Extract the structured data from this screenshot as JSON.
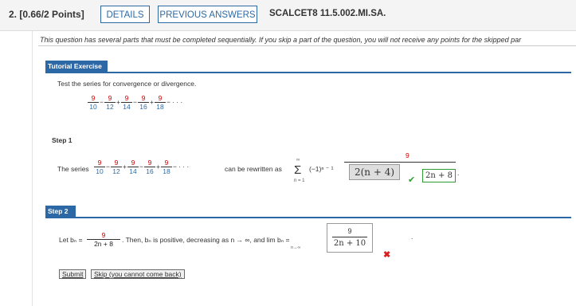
{
  "header": {
    "question_label": "2. [0.66/2 Points]",
    "details_button": "DETAILS",
    "previous_answers_button": "PREVIOUS ANSWERS",
    "problem_code": "SCALCET8 11.5.002.MI.SA."
  },
  "notice": "This question has several parts that must be completed sequentially. If you skip a part of the question, you will not receive any points for the skipped par",
  "tutorial": {
    "tab_label": "Tutorial Exercise",
    "instruction": "Test the series for convergence or divergence.",
    "series_terms": [
      {
        "num": "9",
        "den": "10"
      },
      {
        "num": "9",
        "den": "12"
      },
      {
        "num": "9",
        "den": "14"
      },
      {
        "num": "9",
        "den": "16"
      },
      {
        "num": "9",
        "den": "18"
      }
    ],
    "series_ops": [
      "−",
      "+",
      "−",
      "+",
      "−"
    ],
    "ellipsis": "· · ·"
  },
  "step1": {
    "label": "Step 1",
    "prefix": "The series",
    "rewritten_text": "can be rewritten as",
    "sigma_top": "∞",
    "sigma_bottom": "n = 1",
    "power_term": "(−1)ⁿ ⁻ ¹",
    "fraction_numerator": "9",
    "answer_box": "2(n + 4)",
    "correct_answer": "2n + 8",
    "trailing": "."
  },
  "step2": {
    "tab_label": "Step 2",
    "let_text": "Let  bₙ  =",
    "bn_numerator": "9",
    "bn_denominator": "2n + 8",
    "then_text": ". Then, bₙ is positive, decreasing as n → ∞, and  lim  bₙ  =",
    "lim_sub": "n→∞",
    "answer_numerator": "9",
    "answer_denominator": "2n + 10",
    "trailing": "."
  },
  "buttons": {
    "submit": "Submit",
    "skip": "Skip (you cannot come back)"
  },
  "colors": {
    "accent_blue": "#2c68a6",
    "correct_green": "#2e9e34",
    "incorrect_red": "#d82020",
    "numerator_red": "#cc0000"
  }
}
